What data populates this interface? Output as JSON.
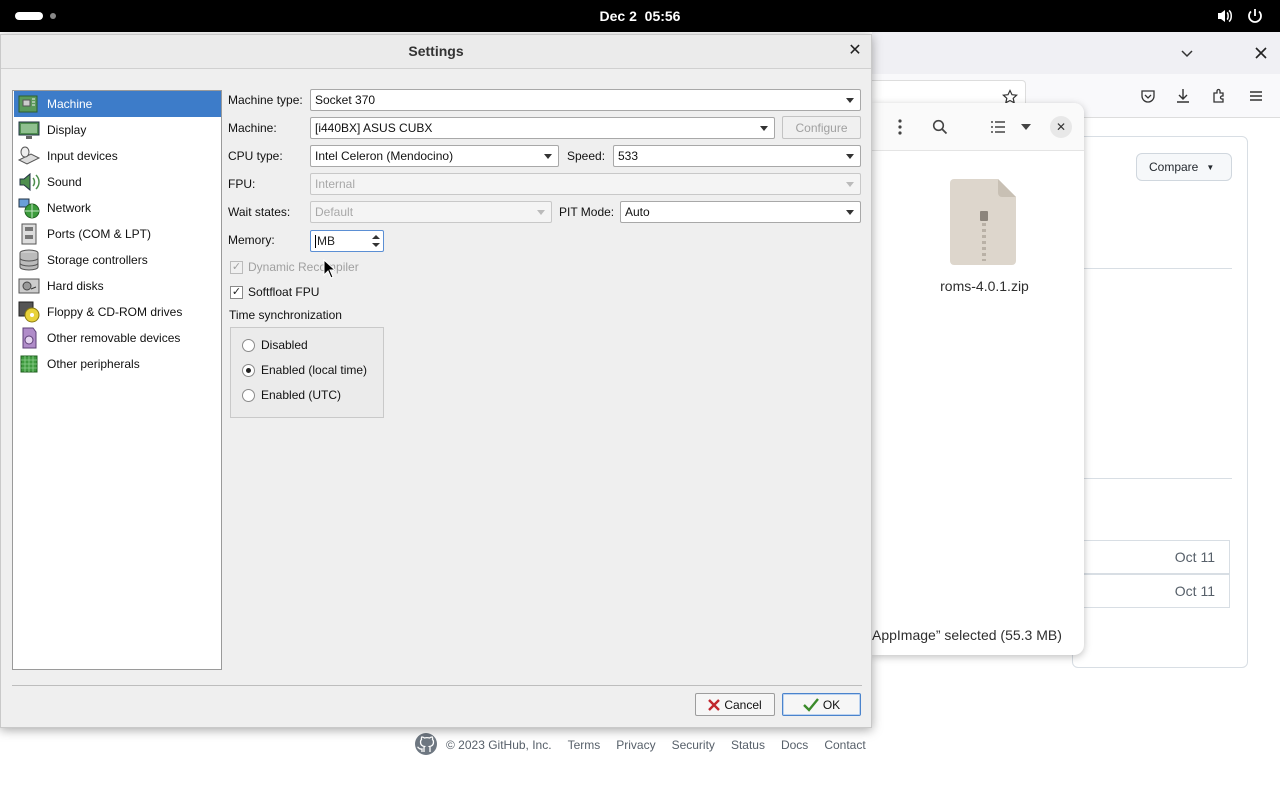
{
  "system": {
    "clock_date": "Dec 2",
    "clock_time": "05:56"
  },
  "background_window": {
    "compare_label": "Compare",
    "file_name": "roms-4.0.1.zip",
    "status_text": "AppImage” selected  (55.3 MB)",
    "rows": [
      {
        "date": "Oct 11"
      },
      {
        "date": "Oct 11"
      }
    ],
    "footer": {
      "copyright": "© 2023 GitHub, Inc.",
      "links": [
        "Terms",
        "Privacy",
        "Security",
        "Status",
        "Docs",
        "Contact"
      ]
    }
  },
  "settings": {
    "title": "Settings",
    "nav": [
      {
        "label": "Machine",
        "icon": "motherboard-icon",
        "selected": true
      },
      {
        "label": "Display",
        "icon": "display-icon"
      },
      {
        "label": "Input devices",
        "icon": "keyboard-mouse-icon"
      },
      {
        "label": "Sound",
        "icon": "speaker-icon"
      },
      {
        "label": "Network",
        "icon": "network-icon"
      },
      {
        "label": "Ports (COM & LPT)",
        "icon": "ports-icon"
      },
      {
        "label": "Storage controllers",
        "icon": "storage-controller-icon"
      },
      {
        "label": "Hard disks",
        "icon": "hard-disk-icon"
      },
      {
        "label": "Floppy & CD-ROM drives",
        "icon": "floppy-cdrom-icon"
      },
      {
        "label": "Other removable devices",
        "icon": "removable-device-icon"
      },
      {
        "label": "Other peripherals",
        "icon": "peripheral-chip-icon"
      }
    ],
    "machine": {
      "machine_type_label": "Machine type:",
      "machine_type_value": "Socket 370",
      "machine_label": "Machine:",
      "machine_value": "[i440BX] ASUS CUBX",
      "configure_label": "Configure",
      "cpu_type_label": "CPU type:",
      "cpu_type_value": "Intel Celeron (Mendocino)",
      "speed_label": "Speed:",
      "speed_value": "533",
      "fpu_label": "FPU:",
      "fpu_value": "Internal",
      "wait_states_label": "Wait states:",
      "wait_states_value": "Default",
      "pit_mode_label": "PIT Mode:",
      "pit_mode_value": "Auto",
      "memory_label": "Memory:",
      "memory_value": "MB",
      "dynamic_recompiler_label": "Dynamic Recompiler",
      "dynamic_recompiler_checked": true,
      "softfloat_label": "Softfloat FPU",
      "softfloat_checked": true,
      "time_sync_label": "Time synchronization",
      "time_sync_options": [
        {
          "label": "Disabled",
          "selected": false
        },
        {
          "label": "Enabled (local time)",
          "selected": true
        },
        {
          "label": "Enabled (UTC)",
          "selected": false
        }
      ]
    },
    "buttons": {
      "cancel": "Cancel",
      "ok": "OK"
    }
  }
}
